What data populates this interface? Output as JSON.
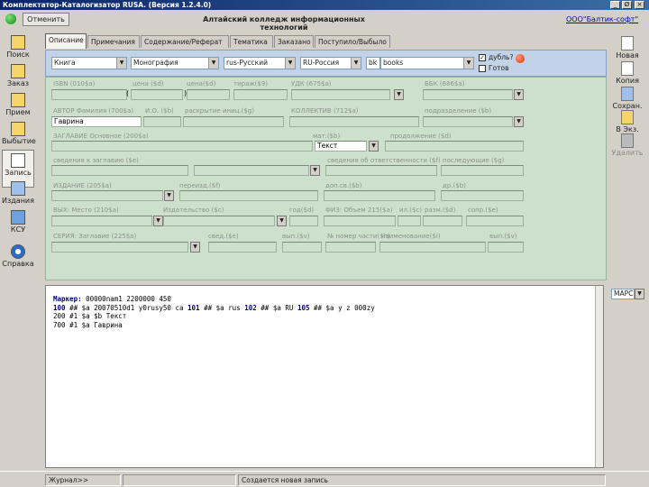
{
  "window": {
    "title": "Комплектатор-Каталогизатор RUSA. (Версия 1.2.4.0)",
    "buttons": [
      "_",
      "Ø",
      "×"
    ]
  },
  "topbar": {
    "cancel_label": "Отменить",
    "college": "Алтайский колледж информационных технологий",
    "vendor": "ООО\"Балтик-софт\""
  },
  "sidebar": {
    "items": [
      {
        "label": "Поиск",
        "icon": "folder-search-icon"
      },
      {
        "label": "Заказ",
        "icon": "folder-order-icon"
      },
      {
        "label": "Прием",
        "icon": "folder-receive-icon"
      },
      {
        "label": "Выбытие",
        "icon": "folder-dispose-icon"
      },
      {
        "label": "Запись",
        "icon": "record-icon"
      },
      {
        "label": "Издания",
        "icon": "editions-icon"
      },
      {
        "label": "КСУ",
        "icon": "ksu-icon"
      },
      {
        "label": "Справка",
        "icon": "help-icon"
      }
    ]
  },
  "toolbar_right": {
    "items": [
      {
        "label": "Новая",
        "icon": "new-record-icon"
      },
      {
        "label": "Копия",
        "icon": "copy-icon"
      },
      {
        "label": "Сохран.",
        "icon": "save-icon"
      },
      {
        "label": "В Экз.",
        "icon": "to-copies-icon"
      },
      {
        "label": "Удалить",
        "icon": "delete-icon"
      }
    ]
  },
  "tabs": [
    "Описание",
    "Примечания",
    "Содержание/Реферат",
    "Тематика",
    "Заказано",
    "Поступило/Выбыло"
  ],
  "controls": {
    "doc_type": "Книга",
    "level": "Монография",
    "language": "rus-Русский",
    "country": "RU-Россия",
    "code": "bk",
    "code_value": "books",
    "duplicate_label": "дубль?",
    "duplicate_check": "✓",
    "temp_label": "Готов"
  },
  "form": {
    "isbn_label": "ISBN (010$a)",
    "price_label": "цена ($d)",
    "binding_label": "цена($d)",
    "print_run_label": "тираж($9)",
    "udk_label": "УДК (675$a)",
    "bbk_label": "ББК (686$a)",
    "author_label": "АВТОР Фамилия (700$a)",
    "initials_label": "И.О. ($b)",
    "reading_label": "раскрытие иниц.($g)",
    "collective_label": "КОЛЛЕКТИВ (712$a)",
    "subdivision_label": "подразделение ($b)",
    "author_value": "Гаврина",
    "title_label": "ЗАГЛАВИЕ Основное (200$a)",
    "gmd_label": "мат.($b)",
    "continuation_label": "продолжение ($d)",
    "gmd_value": "Текст",
    "parallel_label": "сведения к заглавию ($e)",
    "resp_label": "сведения об ответственности ($f)",
    "subsequent_label": "последующие ($g)",
    "edition_label": "ИЗДАНИЕ (205$a)",
    "reissue_label": "переизд.($f)",
    "edition_info_label": "доп.св.($b)",
    "edition_other_label": "др.($b)",
    "place_label": "ВЫХ: Место (210$a)",
    "publisher_label": "Издательство ($c)",
    "year_label": "год($d)",
    "pages_label": "ФИЗ: Объем 215($a)",
    "ill_label": "ил.($c)",
    "size_label": "разм.($d)",
    "supp_label": "сопр.($e)",
    "series_label": "СЕРИЯ: Заглавие (225$a)",
    "series_resp_label": "свед.($e)",
    "series_vol_label": "вып.($v)",
    "series_part_label": "№ номер части($h)",
    "series_part_title_label": "наименование($i)",
    "series_issn_label": "вып.($v)"
  },
  "marc": {
    "lines": [
      {
        "tag": "Маркер:",
        "text": "00000nam1 2200000 450"
      },
      {
        "tag": "100",
        "text": "##  $a 20070510d1 y0rusy50 ca"
      },
      {
        "tag": "101",
        "text": "##  $a rus"
      },
      {
        "tag": "102",
        "text": "##  $a RU"
      },
      {
        "tag": "105",
        "text": "##  $a y z 000zy"
      },
      {
        "tag": "200",
        "text": "#1  $a                    $b Текст"
      },
      {
        "tag": "700",
        "text": "#1  $a Гаврина"
      }
    ],
    "format": "МАРС"
  },
  "status": {
    "left": "Журнал>>",
    "middle": "",
    "right": "Создается новая запись"
  }
}
